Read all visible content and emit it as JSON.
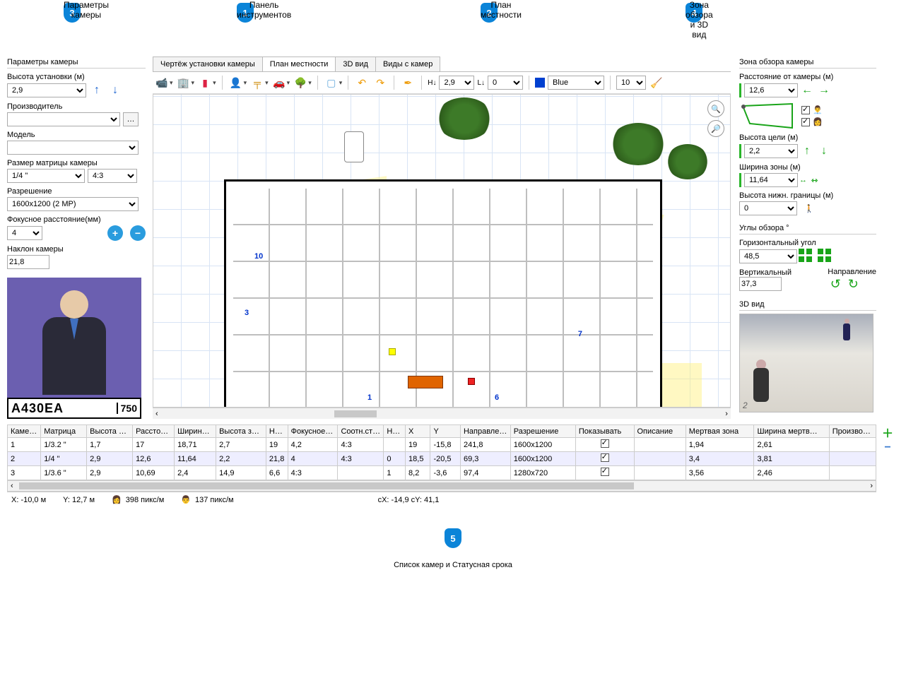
{
  "annotations": {
    "a1": "Панель инструментов",
    "a2": "План местности",
    "a3": "Параметры камеры",
    "a4": "Зона обзора и 3D вид",
    "a5": "Список камер и Статусная срока"
  },
  "left": {
    "panel_title": "Параметры камеры",
    "height_label": "Высота установки (м)",
    "height_value": "2,9",
    "manufacturer_label": "Производитель",
    "model_label": "Модель",
    "sensor_label": "Размер матрицы камеры",
    "sensor_size": "1/4 \"",
    "aspect": "4:3",
    "resolution_label": "Разрешение",
    "resolution_value": "1600x1200 (2 MP)",
    "focal_label": "Фокусное расстояние(мм)",
    "focal_value": "4",
    "tilt_label": "Наклон камеры",
    "tilt_value": "21,8",
    "plate_main": "А430ЕА",
    "plate_region": "750"
  },
  "tabs": {
    "t1": "Чертёж установки камеры",
    "t2": "План местности",
    "t3": "3D вид",
    "t4": "Виды с камер"
  },
  "toolbar": {
    "h_label": "H↓",
    "h_value": "2,9",
    "l_label": "L↓",
    "l_value": "0",
    "color_value": "Blue",
    "line_value": "10"
  },
  "right": {
    "zone_title": "Зона обзора камеры",
    "distance_label": "Расстояние от камеры (м)",
    "distance_value": "12,6",
    "target_h_label": "Высота цели (м)",
    "target_h_value": "2,2",
    "zone_w_label": "Ширина зоны (м)",
    "zone_w_value": "11,64",
    "lower_h_label": "Высота нижн. границы (м)",
    "lower_h_value": "0",
    "angles_title": "Углы обзора °",
    "hangle_label": "Горизонтальный угол",
    "hangle_value": "48,5",
    "vangle_label": "Вертикальный",
    "vangle_value": "37,3",
    "dir_label": "Направление",
    "view3d_title": "3D вид",
    "view3d_badge": "2"
  },
  "cameras": {
    "headers": [
      "Каме…",
      "Матрица",
      "Высота …",
      "Рассто…",
      "Ширин…",
      "Высота з…",
      "Н…",
      "Фокусное…",
      "Соотн.ст…",
      "Н…",
      "X",
      "Y",
      "Направле…",
      "Разрешение",
      "Показывать",
      "Описание",
      "Мертвая зона",
      "Ширина мертв…",
      "Произво…"
    ],
    "rows": [
      [
        "1",
        "1/3.2 \"",
        "1,7",
        "17",
        "18,71",
        "2,7",
        "19",
        "4,2",
        "4:3",
        "",
        "19",
        "-15,8",
        "241,8",
        "1600x1200",
        "checked",
        "",
        "1,94",
        "2,61",
        ""
      ],
      [
        "2",
        "1/4 \"",
        "2,9",
        "12,6",
        "11,64",
        "2,2",
        "21,8",
        "4",
        "4:3",
        "0",
        "18,5",
        "-20,5",
        "69,3",
        "1600x1200",
        "checked",
        "",
        "3,4",
        "3,81",
        ""
      ],
      [
        "3",
        "1/3.6 \"",
        "2,9",
        "10,69",
        "2,4",
        "14,9",
        "6,6",
        "4:3",
        "",
        "1",
        "8,2",
        "-3,6",
        "97,4",
        "1280x720",
        "checked",
        "",
        "3,56",
        "2,46",
        ""
      ]
    ]
  },
  "status": {
    "x": "X: -10,0 м",
    "y": "Y: 12,7 м",
    "ppm1": "398 пикс/м",
    "ppm2": "137 пикс/м",
    "cxy": "сX: -14,9 сY: 41,1"
  }
}
